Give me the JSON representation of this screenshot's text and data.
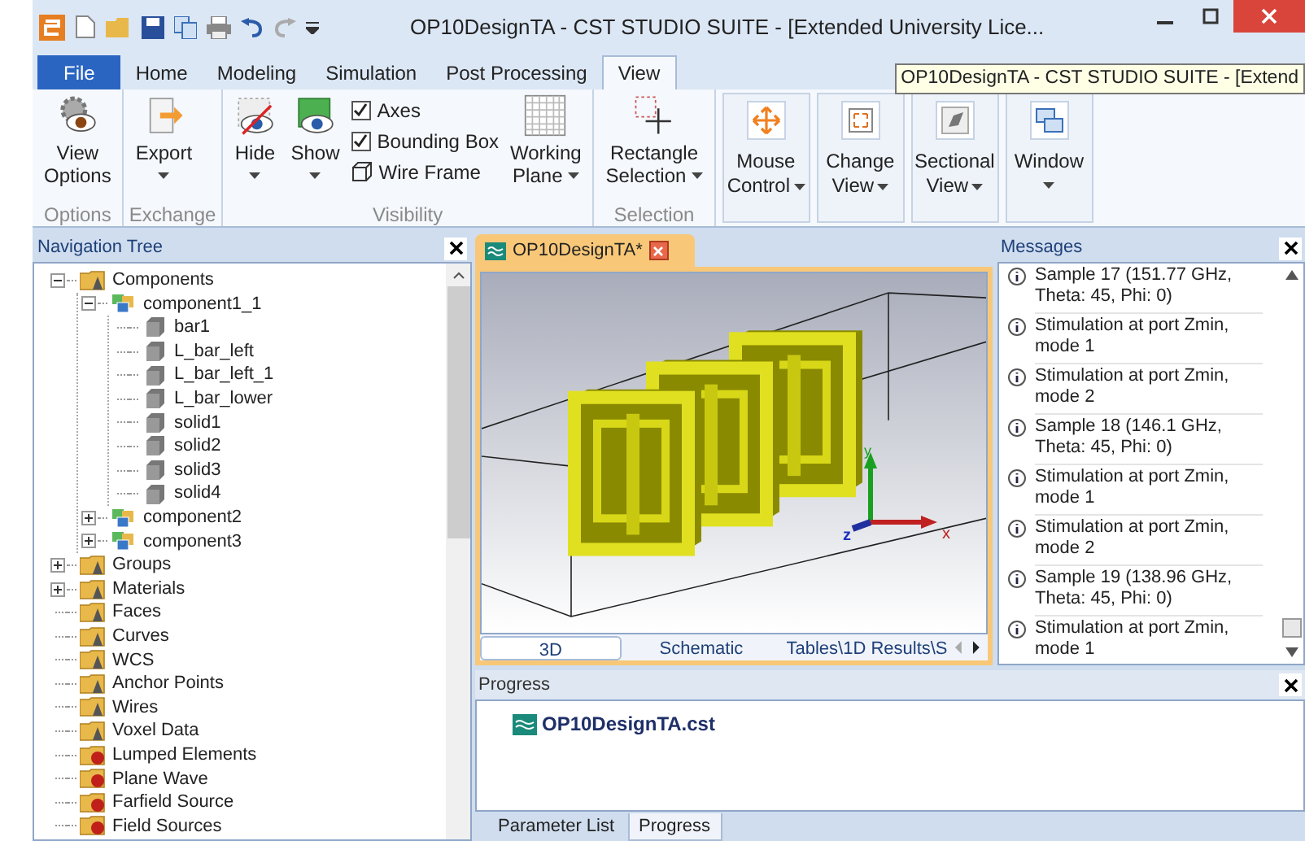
{
  "window": {
    "title": "OP10DesignTA - CST STUDIO SUITE - [Extended University Lice..."
  },
  "tooltip": "OP10DesignTA - CST STUDIO SUITE - [Extend",
  "ribbon_tabs": [
    {
      "label": "File",
      "kind": "file",
      "selected": false
    },
    {
      "label": "Home",
      "kind": "tab",
      "selected": false
    },
    {
      "label": "Modeling",
      "kind": "tab",
      "selected": false
    },
    {
      "label": "Simulation",
      "kind": "tab",
      "selected": false
    },
    {
      "label": "Post Processing",
      "kind": "tab",
      "selected": false
    },
    {
      "label": "View",
      "kind": "tab",
      "selected": true
    }
  ],
  "ribbon_groups": [
    {
      "label": "Options",
      "items": [
        {
          "kind": "large",
          "lines": [
            "View",
            "Options"
          ],
          "dropdown": false
        }
      ]
    },
    {
      "label": "Exchange",
      "items": [
        {
          "kind": "large",
          "lines": [
            "Export"
          ],
          "dropdown": true
        }
      ]
    },
    {
      "label": "Visibility",
      "items": [
        {
          "kind": "large",
          "lines": [
            "Hide"
          ],
          "dropdown": true
        },
        {
          "kind": "large",
          "lines": [
            "Show"
          ],
          "dropdown": true
        },
        {
          "kind": "stack",
          "rows": [
            {
              "kind": "checkbox",
              "label": "Axes",
              "checked": true
            },
            {
              "kind": "checkbox",
              "label": "Bounding Box",
              "checked": true
            },
            {
              "kind": "button",
              "label": "Wire Frame"
            }
          ]
        },
        {
          "kind": "large",
          "lines": [
            "Working",
            "Plane"
          ],
          "dropdown": true
        }
      ]
    },
    {
      "label": "Selection",
      "items": [
        {
          "kind": "large",
          "lines": [
            "Rectangle",
            "Selection"
          ],
          "dropdown": true
        }
      ]
    }
  ],
  "ribbon_panels": [
    {
      "lines": [
        "Mouse",
        "Control"
      ]
    },
    {
      "lines": [
        "Change",
        "View"
      ]
    },
    {
      "lines": [
        "Sectional",
        "View"
      ]
    },
    {
      "lines": [
        "Window"
      ]
    }
  ],
  "navigation_tree": {
    "title": "Navigation Tree",
    "items": [
      {
        "label": "Components",
        "kind": "folder",
        "expanded": true,
        "children": [
          {
            "label": "component1_1",
            "kind": "component",
            "expanded": true,
            "children": [
              {
                "label": "bar1",
                "kind": "solid"
              },
              {
                "label": "L_bar_left",
                "kind": "solid"
              },
              {
                "label": "L_bar_left_1",
                "kind": "solid"
              },
              {
                "label": "L_bar_lower",
                "kind": "solid"
              },
              {
                "label": "solid1",
                "kind": "solid"
              },
              {
                "label": "solid2",
                "kind": "solid"
              },
              {
                "label": "solid3",
                "kind": "solid"
              },
              {
                "label": "solid4",
                "kind": "solid"
              }
            ]
          },
          {
            "label": "component2",
            "kind": "component",
            "expanded": false
          },
          {
            "label": "component3",
            "kind": "component",
            "expanded": false
          }
        ]
      },
      {
        "label": "Groups",
        "kind": "folder",
        "expanded": false
      },
      {
        "label": "Materials",
        "kind": "folder",
        "expanded": false
      },
      {
        "label": "Faces",
        "kind": "folder"
      },
      {
        "label": "Curves",
        "kind": "folder"
      },
      {
        "label": "WCS",
        "kind": "folder"
      },
      {
        "label": "Anchor Points",
        "kind": "folder"
      },
      {
        "label": "Wires",
        "kind": "folder"
      },
      {
        "label": "Voxel Data",
        "kind": "folder"
      },
      {
        "label": "Lumped Elements",
        "kind": "source"
      },
      {
        "label": "Plane Wave",
        "kind": "source"
      },
      {
        "label": "Farfield Source",
        "kind": "source"
      },
      {
        "label": "Field Sources",
        "kind": "source"
      }
    ]
  },
  "document": {
    "tab": "OP10DesignTA*",
    "axes": [
      "y",
      "z",
      "x"
    ],
    "view_tabs": [
      {
        "label": "3D",
        "selected": true
      },
      {
        "label": "Schematic",
        "selected": false
      },
      {
        "label": "Tables\\1D Results\\S",
        "selected": false
      }
    ]
  },
  "messages": {
    "title": "Messages",
    "items": [
      "Sample 17 (151.77 GHz, Theta: 45, Phi: 0)",
      "Stimulation at port Zmin, mode 1",
      "Stimulation at port Zmin, mode 2",
      "Sample 18 (146.1 GHz, Theta: 45, Phi: 0)",
      "Stimulation at port Zmin, mode 1",
      "Stimulation at port Zmin, mode 2",
      "Sample 19 (138.96 GHz, Theta: 45, Phi: 0)",
      "Stimulation at port Zmin, mode 1"
    ]
  },
  "progress": {
    "title": "Progress",
    "file": "OP10DesignTA.cst"
  },
  "bottom_tabs": [
    {
      "label": "Parameter List",
      "selected": false
    },
    {
      "label": "Progress",
      "selected": true
    }
  ]
}
